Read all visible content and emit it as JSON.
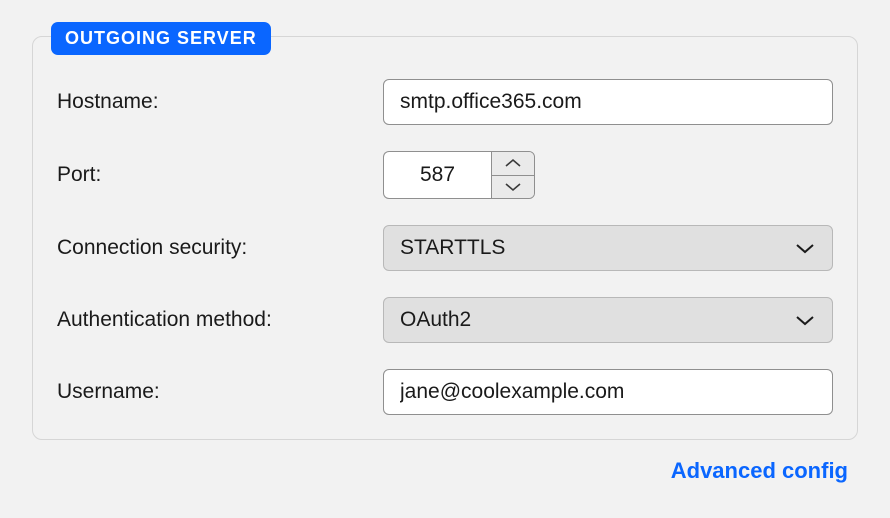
{
  "section": {
    "title": "OUTGOING SERVER"
  },
  "labels": {
    "hostname": "Hostname:",
    "port": "Port:",
    "connection_security": "Connection security:",
    "auth_method": "Authentication method:",
    "username": "Username:"
  },
  "values": {
    "hostname": "smtp.office365.com",
    "port": "587",
    "connection_security": "STARTTLS",
    "auth_method": "OAuth2",
    "username": "jane@coolexample.com"
  },
  "footer": {
    "advanced_config": "Advanced config"
  }
}
